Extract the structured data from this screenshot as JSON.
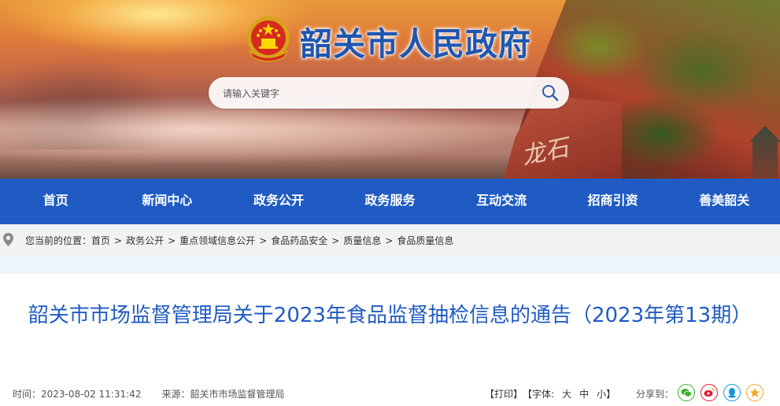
{
  "site": {
    "title": "韶关市人民政府"
  },
  "search": {
    "placeholder": "请输入关键字"
  },
  "nav": [
    "首页",
    "新闻中心",
    "政务公开",
    "政务服务",
    "互动交流",
    "招商引资",
    "善美韶关"
  ],
  "breadcrumb": {
    "prefix": "您当前的位置：",
    "items": [
      "首页",
      "政务公开",
      "重点领域信息公开",
      "食品药品安全",
      "质量信息",
      "食品质量信息"
    ],
    "separator": ">"
  },
  "article": {
    "title": "韶关市市场监督管理局关于2023年食品监督抽检信息的通告（2023年第13期）",
    "time": "时间：2023-08-02 11:31:42",
    "source": "来源：韶关市市场监督管理局"
  },
  "tools": {
    "print": "【打印】",
    "font_prefix": "【字体:",
    "font_large": "大",
    "font_medium": "中",
    "font_small": "小",
    "font_suffix": "】",
    "share_label": "分享到："
  },
  "share_icons": [
    {
      "name": "wechat-icon",
      "color": "#3cb034"
    },
    {
      "name": "weibo-icon",
      "color": "#e6162d"
    },
    {
      "name": "qq-icon",
      "color": "#1296db"
    },
    {
      "name": "qzone-icon",
      "color": "#f5a623"
    }
  ],
  "colors": {
    "brand_blue": "#1f5bc2"
  }
}
